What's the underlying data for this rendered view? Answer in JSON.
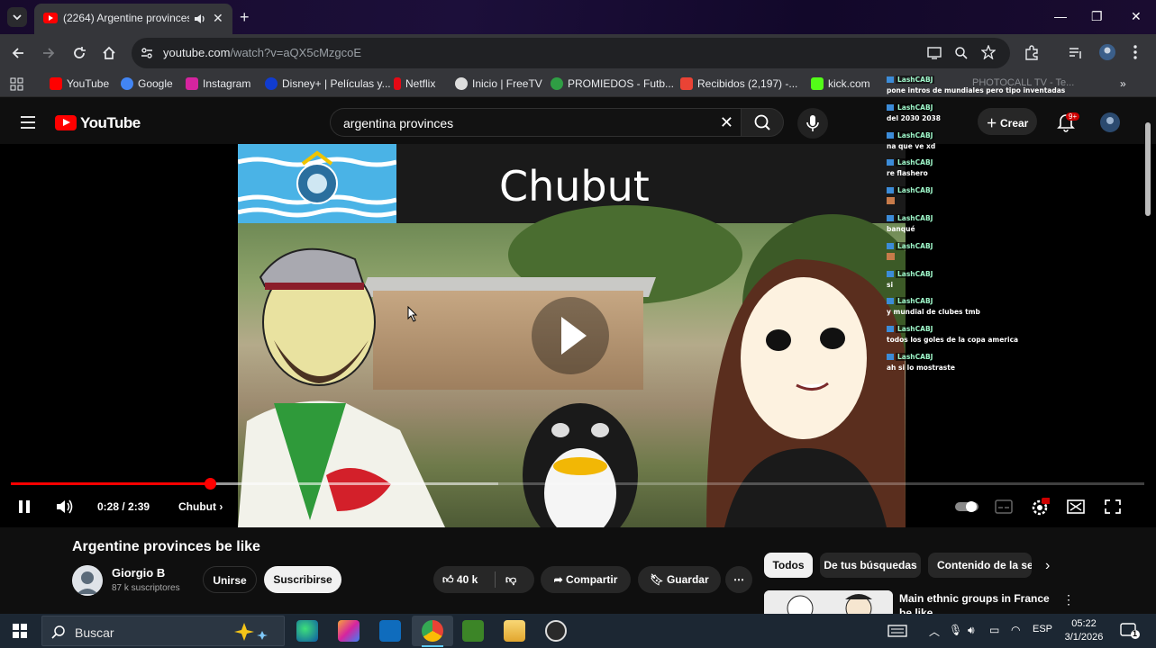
{
  "browser": {
    "tab_title": "(2264) Argentine provinces",
    "url_host": "youtube.com",
    "url_path": "/watch?v=aQX5cMzgcoE",
    "bookmarks": [
      {
        "label": "YouTube",
        "color": "#ff0000"
      },
      {
        "label": "Google",
        "color": "#4285f4"
      },
      {
        "label": "Instagram",
        "color": "#d6249f"
      },
      {
        "label": "Disney+ | Películas y...",
        "color": "#113ccf"
      },
      {
        "label": "Netflix",
        "color": "#e50914"
      },
      {
        "label": "Inicio | FreeTV",
        "color": "#dddddd"
      },
      {
        "label": "PROMIEDOS - Futb...",
        "color": "#2f9e44"
      },
      {
        "label": "Recibidos (2,197) -...",
        "color": "#ea4335"
      },
      {
        "label": "kick.com",
        "color": "#53fc18"
      }
    ]
  },
  "youtube": {
    "logo_text": "YouTube",
    "search_query": "argentina provinces",
    "create_label": "Crear",
    "notif_badge": "9+"
  },
  "video": {
    "overlay_title": "Chubut",
    "time_current": "0:28",
    "time_total": "2:39",
    "time_display": "0:28 / 2:39",
    "chapter": "Chubut",
    "progress_fraction": 0.176,
    "buffered_fraction": 0.43
  },
  "chat": {
    "username": "LashCABJ",
    "partial_text": "PHOTOCALL TV - Te...",
    "messages": [
      {
        "text": "pone intros de mundiales pero tipo inventadas",
        "emote": false
      },
      {
        "text": "del 2030 2038",
        "emote": false
      },
      {
        "text": "na que ve xd",
        "emote": false
      },
      {
        "text": "re flashero",
        "emote": false
      },
      {
        "text": "",
        "emote": true
      },
      {
        "text": "banqué",
        "emote": false
      },
      {
        "text": "",
        "emote": true
      },
      {
        "text": "si",
        "emote": false
      },
      {
        "text": "y mundial de clubes tmb",
        "emote": false
      },
      {
        "text": "todos los goles de la copa america",
        "emote": false
      },
      {
        "text": "ah si lo mostraste",
        "emote": false
      }
    ]
  },
  "meta": {
    "title": "Argentine provinces be like",
    "channel": "Giorgio B",
    "subscribers": "87 k suscriptores",
    "join_label": "Unirse",
    "subscribe_label": "Suscribirse",
    "likes": "40 k",
    "share_label": "Compartir",
    "save_label": "Guardar",
    "chips": [
      "Todos",
      "De tus búsquedas",
      "Contenido de la ser"
    ],
    "rec_title": "Main ethnic groups in France be like"
  },
  "taskbar": {
    "search_label": "Buscar",
    "lang": "ESP",
    "time": "05:22",
    "date": "3/1/2026",
    "notif_count": "1"
  }
}
